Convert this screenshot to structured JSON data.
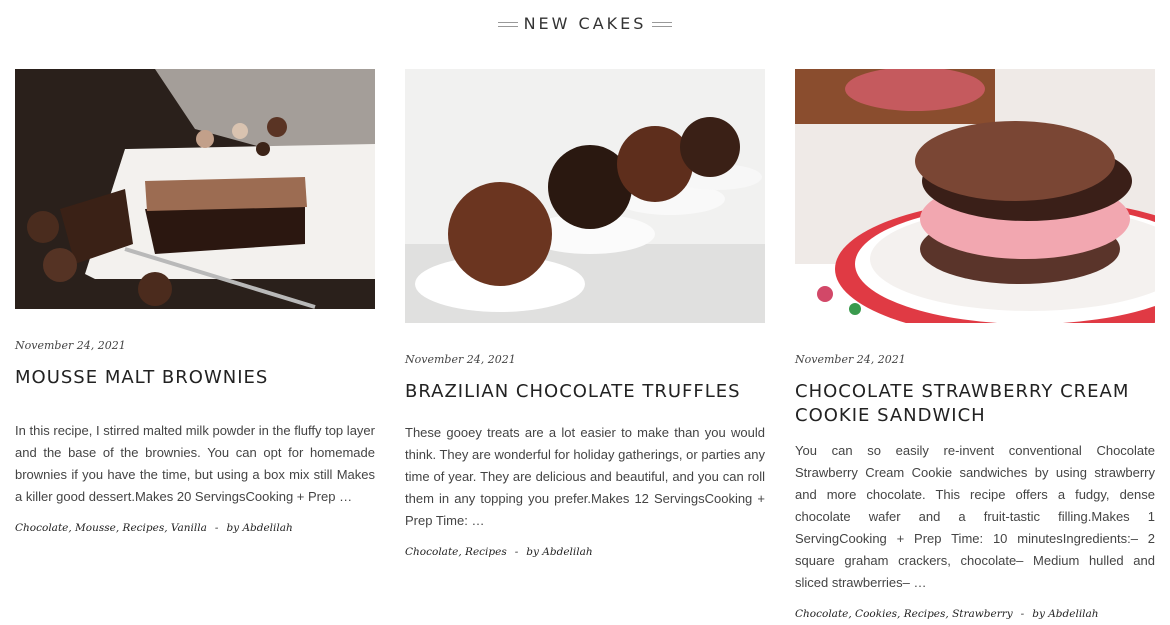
{
  "section": {
    "title": "NEW CAKES"
  },
  "posts": [
    {
      "date": "November 24, 2021",
      "title": "MOUSSE MALT BROWNIES",
      "excerpt": "In this recipe, I stirred malted milk powder in the fluffy top layer and the base of the brownies. You can opt for homemade brownies if you have the time, but using a box mix still Makes a killer good dessert.Makes 20 ServingsCooking + Prep …",
      "tags": "Chocolate, Mousse, Recipes, Vanilla",
      "author": "by Abdelilah",
      "image_label": "mousse-malt-brownies-photo"
    },
    {
      "date": "November 24, 2021",
      "title": "BRAZILIAN CHOCOLATE TRUFFLES",
      "excerpt": "These gooey treats are a lot easier to make than you would think. They are wonderful for holiday gatherings, or parties any time of year. They are delicious and beautiful, and you can roll them in any topping you prefer.Makes 12 ServingsCooking + Prep Time: …",
      "tags": "Chocolate, Recipes",
      "author": "by Abdelilah",
      "image_label": "brazilian-chocolate-truffles-photo"
    },
    {
      "date": "November 24, 2021",
      "title": "CHOCOLATE STRAWBERRY CREAM COOKIE SANDWICH",
      "excerpt": "You can so easily re-invent conventional Chocolate Strawberry Cream Cookie sandwiches by using strawberry and more chocolate. This recipe offers a fudgy, dense chocolate wafer and a fruit-tastic filling.Makes 1 ServingCooking + Prep Time: 10 minutesIngredients:– 2 square graham crackers, chocolate– Medium hulled and sliced strawberries– …",
      "tags": "Chocolate, Cookies, Recipes, Strawberry",
      "author": "by Abdelilah",
      "image_label": "strawberry-cookie-sandwich-photo"
    }
  ]
}
